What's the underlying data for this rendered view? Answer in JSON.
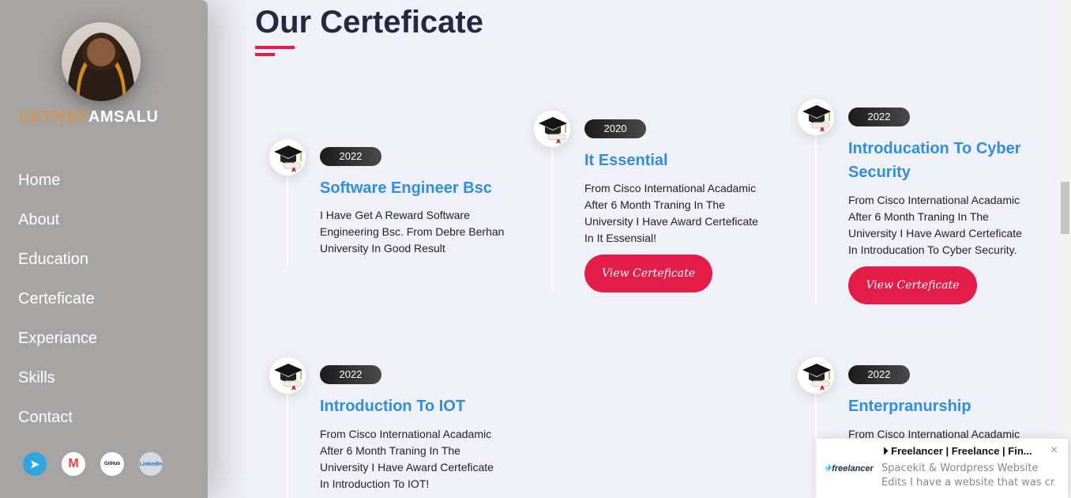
{
  "brand": {
    "first": "GETNET",
    "last": "AMSALU"
  },
  "nav": [
    "Home",
    "About",
    "Education",
    "Certeficate",
    "Experiance",
    "Skills",
    "Contact"
  ],
  "socials": [
    {
      "name": "telegram",
      "glyph": "➤"
    },
    {
      "name": "gmail",
      "glyph": "M"
    },
    {
      "name": "github",
      "glyph": "GitHub"
    },
    {
      "name": "linkedin",
      "glyph": "LinkedIn"
    }
  ],
  "section": {
    "title": "Our Certeficate"
  },
  "cards": [
    {
      "year": "2022",
      "title": "Software Engineer Bsc",
      "desc": "I Have Get A Reward Software Engineering Bsc. From Debre Berhan University In Good Result"
    },
    {
      "year": "2020",
      "title": "It Essential",
      "desc": "From Cisco International Acadamic After 6 Month Traning In The University I Have Award Certeficate In It Essensial!",
      "button": "View Certeficate"
    },
    {
      "year": "2022",
      "title": "Introducation To Cyber Security",
      "desc": "From Cisco International Acadamic After 6 Month Traning In The University I Have Award Certeficate In Introducation To Cyber Security.",
      "button": "View Certeficate"
    },
    {
      "year": "2022",
      "title": "Introduction To IOT",
      "desc": "From Cisco International Acadamic After 6 Month Traning In The University I Have Award Certeficate In Introduction To IOT!"
    },
    {
      "year": "2022",
      "title": "Enterpranurship",
      "desc": "From Cisco International Acadamic"
    }
  ],
  "toast": {
    "title": "Freelancer | Freelance | Fin...",
    "line1": "Spacekit & Wordpress Website",
    "line2": "Edits I have a website that was cr...",
    "logo_text": "freelancer",
    "close": "×"
  },
  "colors": {
    "accent": "#e31c48",
    "link": "#2e8ee0",
    "sidebar": "#a5a4a3"
  }
}
